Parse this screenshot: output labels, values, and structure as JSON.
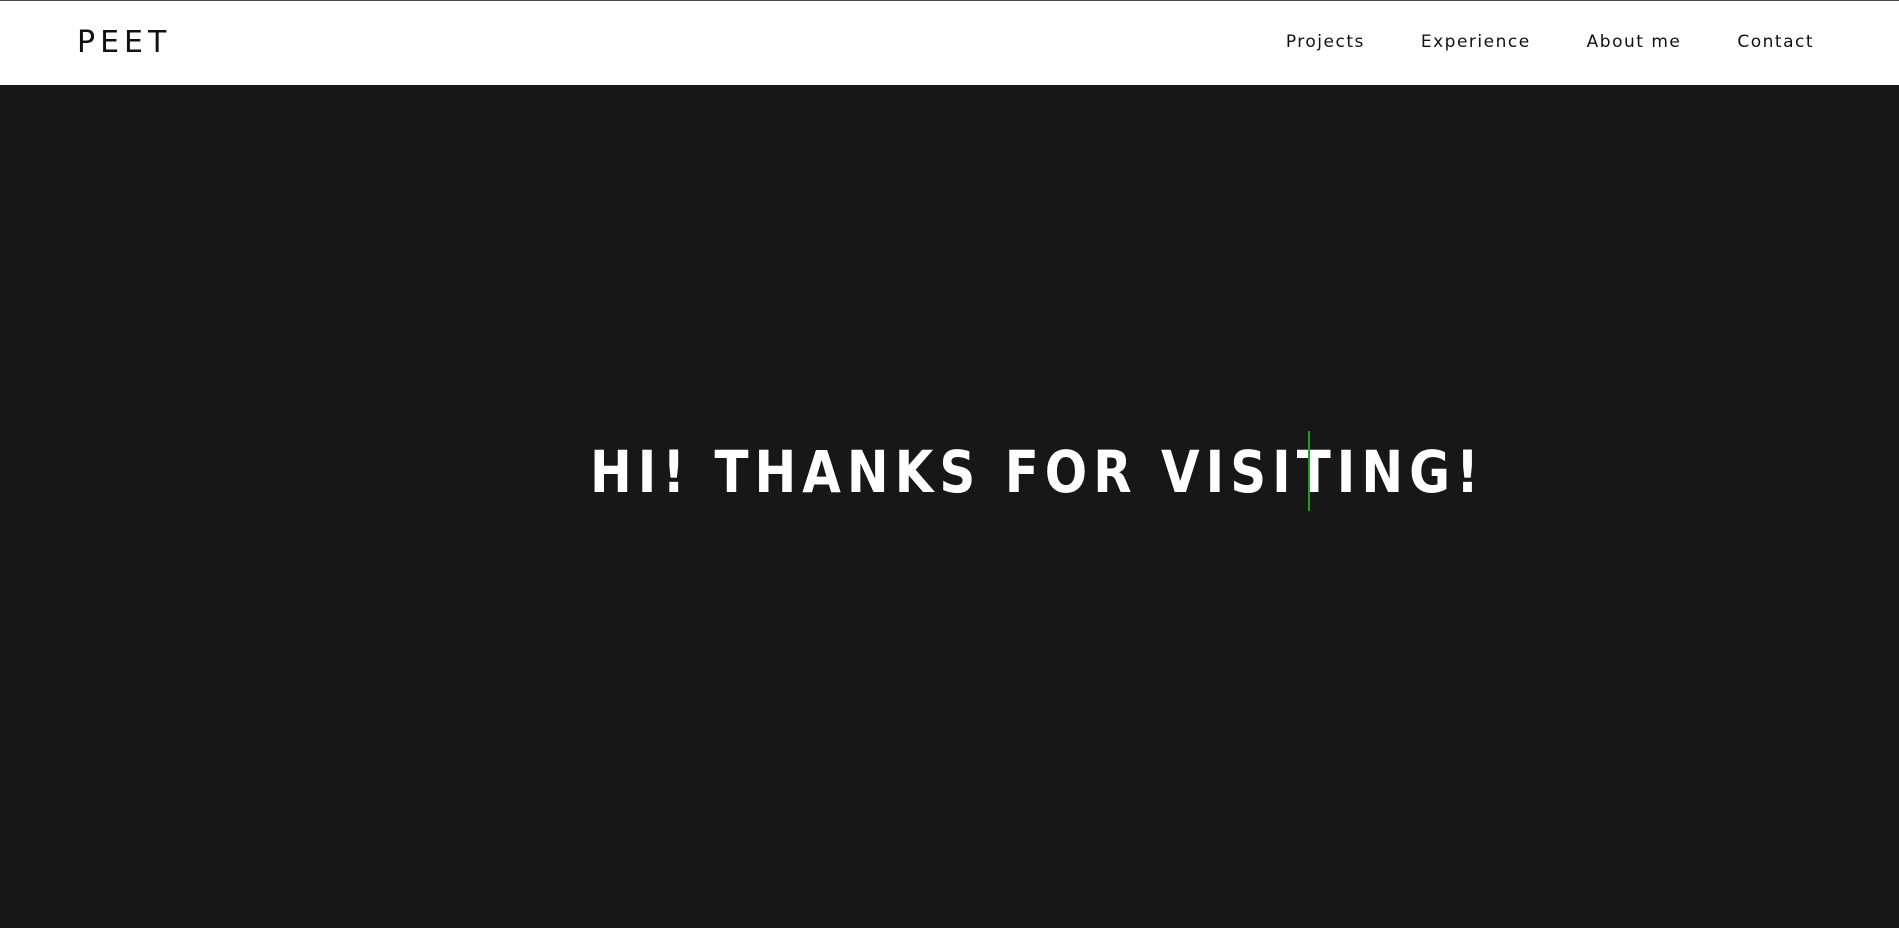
{
  "header": {
    "logo": "PEET",
    "nav": [
      {
        "label": "Projects"
      },
      {
        "label": "Experience"
      },
      {
        "label": "About me"
      },
      {
        "label": "Contact"
      }
    ]
  },
  "hero": {
    "title": "HI! THANKS FOR VISITING!",
    "caret_color": "#1e9e1e"
  },
  "colors": {
    "header_bg": "#ffffff",
    "hero_bg": "#171717",
    "hero_text": "#ffffff",
    "nav_text": "#111111"
  },
  "icons": {
    "typing_cursor": "text-caret-icon"
  }
}
